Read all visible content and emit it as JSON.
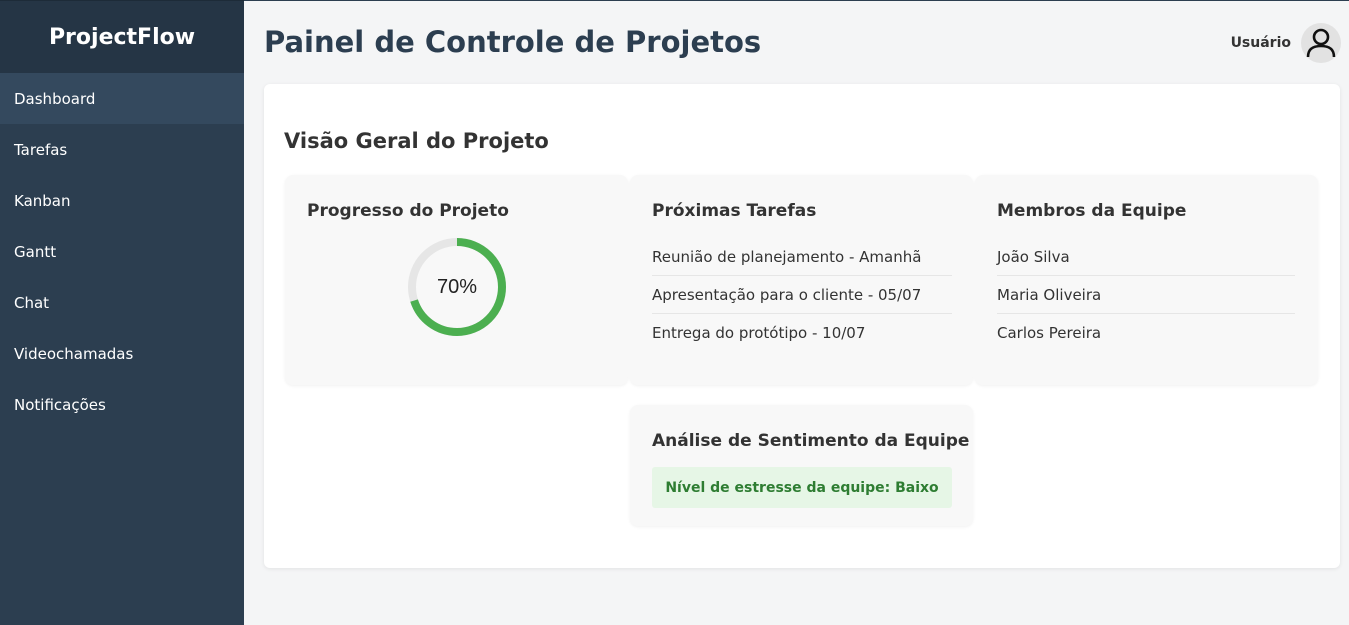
{
  "app": {
    "name": "ProjectFlow"
  },
  "sidebar": {
    "items": [
      {
        "label": "Dashboard"
      },
      {
        "label": "Tarefas"
      },
      {
        "label": "Kanban"
      },
      {
        "label": "Gantt"
      },
      {
        "label": "Chat"
      },
      {
        "label": "Videochamadas"
      },
      {
        "label": "Notificações"
      }
    ]
  },
  "header": {
    "title": "Painel de Controle de Projetos",
    "user_label": "Usuário",
    "avatar_icon": "user-icon"
  },
  "overview": {
    "title": "Visão Geral do Projeto",
    "progress": {
      "title": "Progresso do Projeto",
      "value_label": "70%",
      "value": 0.7,
      "color": "#4caf50",
      "track_color": "#e6e6e6"
    },
    "tasks": {
      "title": "Próximas Tarefas",
      "items": [
        "Reunião de planejamento - Amanhã",
        "Apresentação para o cliente - 05/07",
        "Entrega do protótipo - 10/07"
      ]
    },
    "team": {
      "title": "Membros da Equipe",
      "members": [
        "João Silva",
        "Maria Oliveira",
        "Carlos Pereira"
      ]
    },
    "sentiment": {
      "title": "Análise de Sentimento da Equipe",
      "status": "Nível de estresse da equipe: Baixo",
      "status_color": "#2e7d32",
      "status_bg": "#e6f6e6"
    }
  },
  "colors": {
    "sidebar_bg": "#2c3e50",
    "sidebar_active": "#34495e",
    "accent": "#4caf50"
  }
}
